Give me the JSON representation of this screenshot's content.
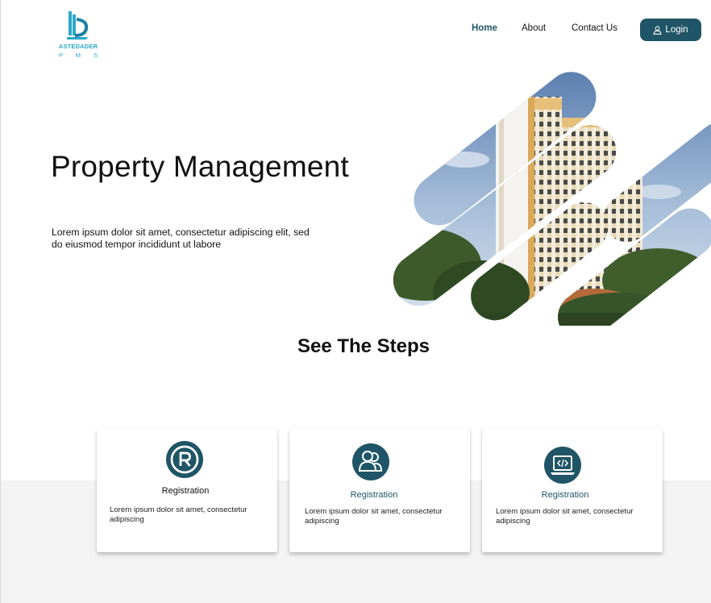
{
  "brand": {
    "name": "ASTEDADER",
    "sub": "P M S",
    "color": "#2aa8c8"
  },
  "nav": {
    "home": "Home",
    "about": "About",
    "contact": "Contact Us",
    "login": "Login",
    "accent": "#1f5566"
  },
  "hero": {
    "title": "Property Management",
    "text": "Lorem ipsum dolor sit amet, consectetur adipiscing elit, sed do eiusmod tempor incididunt ut labore",
    "image": "building-collage"
  },
  "steps": {
    "title": "See The Steps",
    "cards": [
      {
        "icon": "registered-icon",
        "title": "Registration",
        "text": "Lorem ipsum dolor sit amet, consectetur adipiscing"
      },
      {
        "icon": "users-icon",
        "title": "Registration",
        "text": "Lorem ipsum dolor sit amet, consectetur adipiscing"
      },
      {
        "icon": "laptop-code-icon",
        "title": "Registration",
        "text": "Lorem ipsum dolor sit amet, consectetur adipiscing"
      }
    ]
  }
}
